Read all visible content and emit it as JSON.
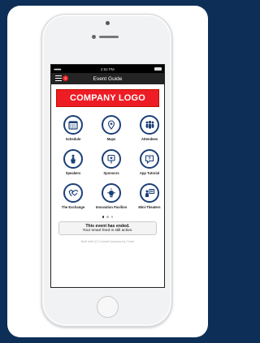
{
  "status_bar": {
    "signal": "●●●●●",
    "time": "2:52 PM"
  },
  "header": {
    "title": "Event Guide",
    "badge_count": "4"
  },
  "logo": {
    "text": "COMPANY LOGO"
  },
  "tiles": [
    {
      "label": "Schedule",
      "icon": "calendar-icon"
    },
    {
      "label": "Maps",
      "icon": "map-pin-icon"
    },
    {
      "label": "Attendees",
      "icon": "people-icon"
    },
    {
      "label": "Speakers",
      "icon": "podium-icon"
    },
    {
      "label": "Sponsors",
      "icon": "sign-icon"
    },
    {
      "label": "App Tutorial",
      "icon": "help-icon"
    },
    {
      "label": "The Exchange",
      "icon": "handshake-icon"
    },
    {
      "label": "Innovation Pavilion",
      "icon": "bulb-icon"
    },
    {
      "label": "Mini-Theaters",
      "icon": "presenter-icon"
    }
  ],
  "pager": {
    "count": 3,
    "active": 0
  },
  "notice": {
    "line1": "This event has ended.",
    "line2": "Your smart feed is still active."
  },
  "footer": {
    "text": "Built with (C) CrowdCompass by Cvent"
  },
  "colors": {
    "background": "#0d2f57",
    "logo_bg": "#ee1c25",
    "icon_ring": "#1c3f78",
    "navbar": "#242424"
  }
}
